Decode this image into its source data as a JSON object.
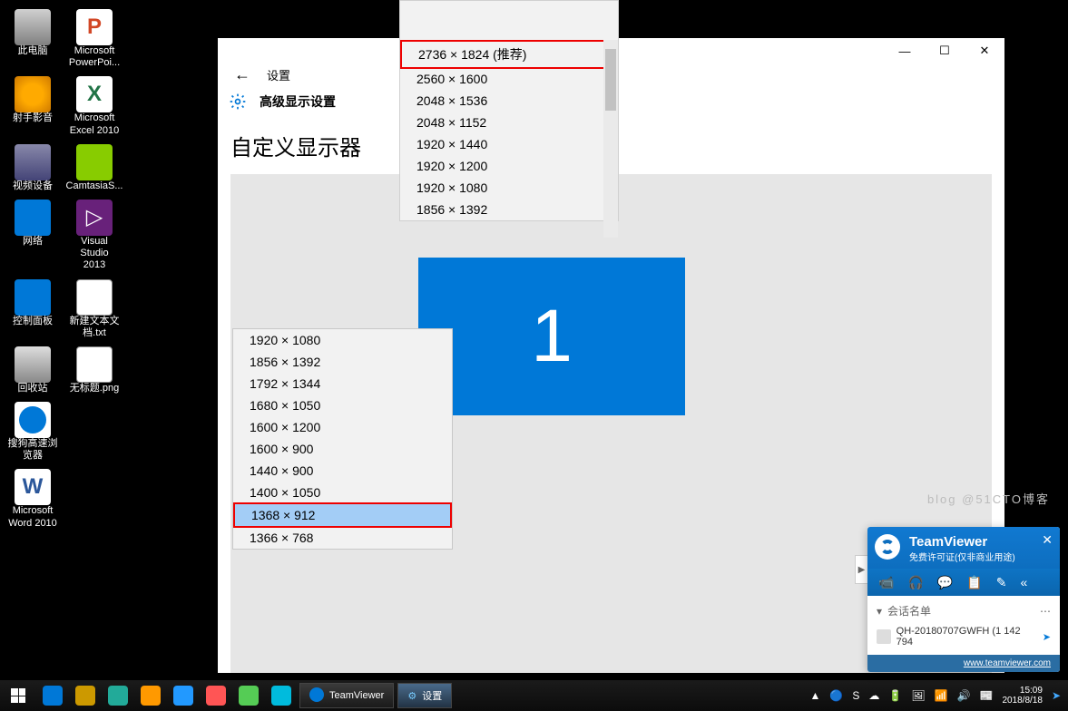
{
  "desktop": {
    "icons": [
      [
        {
          "label": "此电脑",
          "cls": "i-pc"
        },
        {
          "label": "Microsoft PowerPoi...",
          "cls": "i-ppt",
          "g": "P"
        }
      ],
      [
        {
          "label": "射手影音",
          "cls": "i-play"
        },
        {
          "label": "Microsoft Excel 2010",
          "cls": "i-excel",
          "g": "X"
        }
      ],
      [
        {
          "label": "视频设备",
          "cls": "i-cam"
        },
        {
          "label": "CamtasiaS...",
          "cls": "i-camt"
        }
      ],
      [
        {
          "label": "网络",
          "cls": "i-net"
        },
        {
          "label": "Visual Studio 2013",
          "cls": "i-vs",
          "g": "▷"
        }
      ],
      [
        {
          "label": "控制面板",
          "cls": "i-cp"
        },
        {
          "label": "新建文本文档.txt",
          "cls": "i-txt"
        }
      ],
      [
        {
          "label": "回收站",
          "cls": "i-bin"
        },
        {
          "label": "无标题.png",
          "cls": "i-png"
        }
      ],
      [
        {
          "label": "搜狗高速浏览器",
          "cls": "i-sogou"
        },
        {
          "label": "",
          "cls": ""
        }
      ],
      [
        {
          "label": "Microsoft Word 2010",
          "cls": "i-word",
          "g": "W"
        },
        {
          "label": "",
          "cls": ""
        }
      ]
    ]
  },
  "settings": {
    "back": "←",
    "crumb": "设置",
    "adv_title": "高级显示设置",
    "heading": "自定义显示器",
    "monitor_number": "1",
    "window_buttons": {
      "min": "—",
      "max": "☐",
      "close": "✕"
    }
  },
  "dropdown_top": {
    "items": [
      "2736 × 1824 (推荐)",
      "2560 × 1600",
      "2048 × 1536",
      "2048 × 1152",
      "1920 × 1440",
      "1920 × 1200",
      "1920 × 1080",
      "1856 × 1392"
    ],
    "highlight_index": 0
  },
  "dropdown_bottom": {
    "items": [
      "1920 × 1080",
      "1856 × 1392",
      "1792 × 1344",
      "1680 × 1050",
      "1600 × 1200",
      "1600 × 900",
      "1440 × 900",
      "1400 × 1050",
      "1368 × 912",
      "1366 × 768"
    ],
    "selected_index": 8,
    "highlight_index": 8
  },
  "watermark": "blog @51CTO博客",
  "teamviewer": {
    "title": "TeamViewer",
    "subtitle": "免费许可证(仅非商业用途)",
    "tools": [
      "📹",
      "🎧",
      "💬",
      "📋",
      "✎",
      "«"
    ],
    "session_header": "会话名单",
    "session_item": "QH-20180707GWFH (1 142 794",
    "footer": "www.teamviewer.com",
    "tab": "▶"
  },
  "taskbar": {
    "pinned_colors": [
      "#0078d7",
      "#c90",
      "#2a9",
      "#f90",
      "#29f",
      "#f55",
      "#5c5",
      "#0bd"
    ],
    "open": [
      {
        "label": "TeamViewer",
        "icon": "tv"
      },
      {
        "label": "设置",
        "icon": "gear"
      }
    ],
    "clock": {
      "time": "15:09",
      "date": "2018/8/18"
    },
    "tray": [
      "▲",
      "🔵",
      "S",
      "☁",
      "🔋",
      "🖼",
      "📶",
      "🔊",
      "📰"
    ]
  }
}
